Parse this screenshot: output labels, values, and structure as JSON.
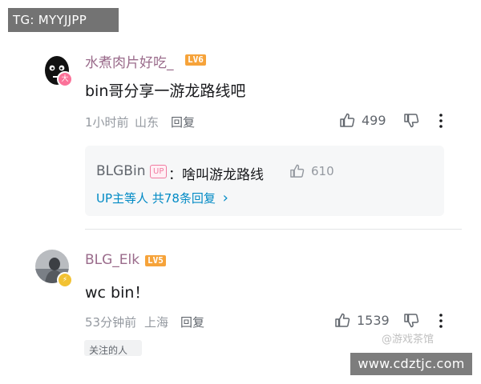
{
  "watermark_top": "TG: MYYJJPP",
  "comments": [
    {
      "username": "水煮肉片好吃_",
      "level": "LV6",
      "level_color": "#f6a33a",
      "avatar_badge": "大",
      "badge_color": "#fb7299",
      "content": "bin哥分享一游龙路线吧",
      "time": "1小时前",
      "location": "山东",
      "reply_label": "回复",
      "likes": "499",
      "sub": {
        "name": "BLGBin",
        "tag": "UP",
        "text": "：啥叫游龙路线",
        "likes": "610",
        "more": "UP主等人 共78条回复",
        "more_chevron": "›"
      }
    },
    {
      "username": "BLG_Elk",
      "level": "LV5",
      "level_color": "#f6a33a",
      "avatar_badge": "⚡",
      "badge_color": "#f2c233",
      "content": "wc bin！",
      "time": "53分钟前",
      "location": "上海",
      "reply_label": "回复",
      "likes": "1539",
      "cut_tag": "关注的人"
    }
  ],
  "watermark_corner": "@游戏茶馆",
  "url_box": "www.cdztjc.com",
  "icons": [
    "like-icon",
    "dislike-icon",
    "more-icon",
    "chevron-right-icon"
  ]
}
